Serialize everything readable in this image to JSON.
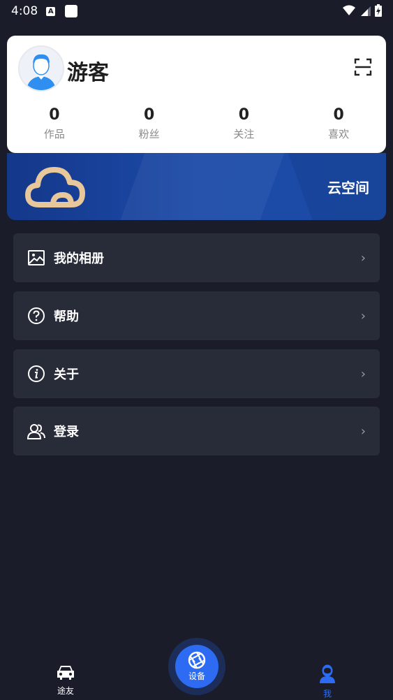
{
  "status_bar": {
    "time": "4:08",
    "notif_icon": "A"
  },
  "profile": {
    "name": "游客",
    "stats": [
      {
        "value": "0",
        "label": "作品"
      },
      {
        "value": "0",
        "label": "粉丝"
      },
      {
        "value": "0",
        "label": "关注"
      },
      {
        "value": "0",
        "label": "喜欢"
      }
    ]
  },
  "cloud_banner": {
    "label": "云空间"
  },
  "menu": [
    {
      "label": "我的相册",
      "icon": "album-icon"
    },
    {
      "label": "帮助",
      "icon": "help-icon"
    },
    {
      "label": "关于",
      "icon": "info-icon"
    },
    {
      "label": "登录",
      "icon": "users-icon"
    }
  ],
  "chevron": "›",
  "bottom_nav": {
    "left": {
      "label": "途友",
      "icon": "car-icon"
    },
    "center": {
      "label": "设备",
      "icon": "aperture-icon"
    },
    "right": {
      "label": "我",
      "icon": "user-icon"
    }
  },
  "colors": {
    "accent": "#2d6cf2",
    "background": "#1a1d29",
    "card": "#282b38",
    "cloud": "#e8c79a"
  }
}
